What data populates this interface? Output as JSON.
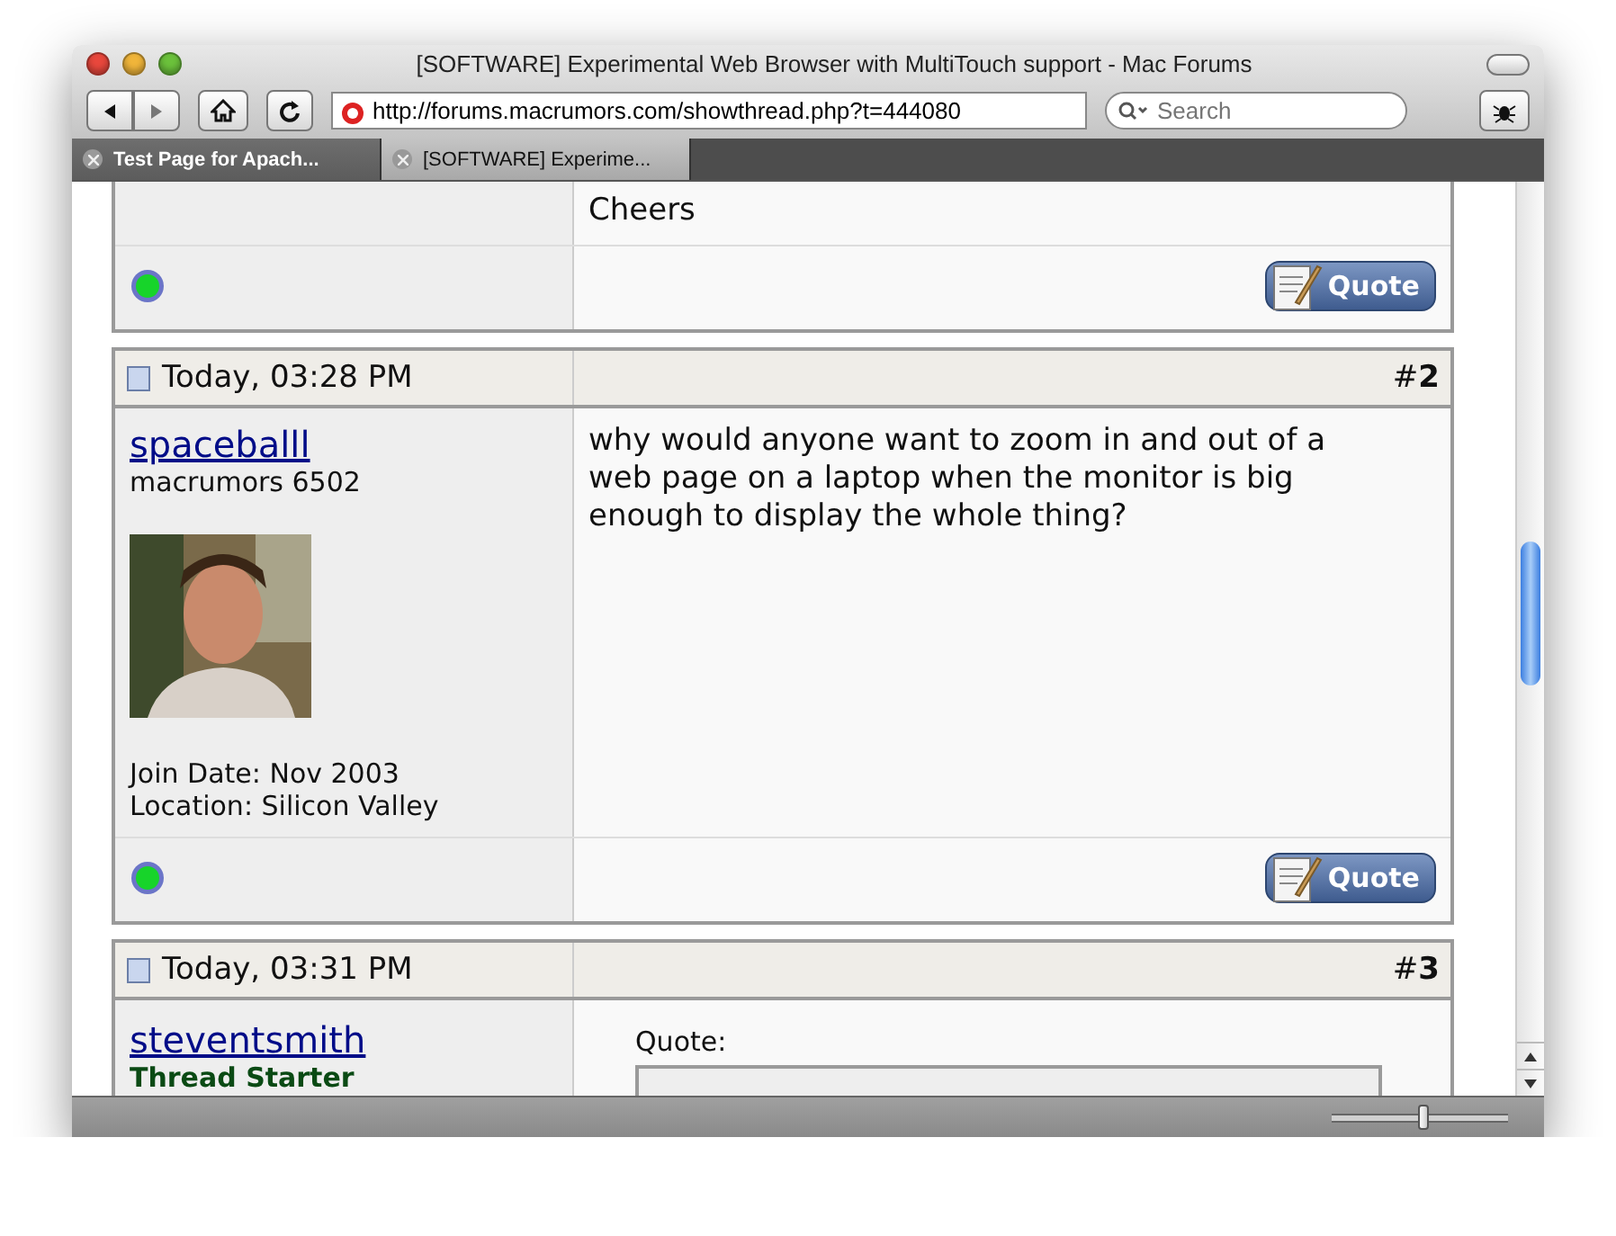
{
  "window": {
    "title": "[SOFTWARE] Experimental Web Browser with MultiTouch support - Mac Forums"
  },
  "toolbar": {
    "url": "http://forums.macrumors.com/showthread.php?t=444080",
    "search": {
      "placeholder": "Search"
    }
  },
  "tabs": [
    {
      "label": "Test Page for Apach...",
      "selected": false
    },
    {
      "label": "[SOFTWARE] Experime...",
      "selected": true
    }
  ],
  "previous_post": {
    "message": "Cheers",
    "online": true,
    "quote_button": "Quote"
  },
  "posts": [
    {
      "kind": "full",
      "date": "Today, 03:28 PM",
      "number": "#**2**",
      "user": {
        "name": "spaceballl",
        "title": "macrumors 6502",
        "join_date": "Join Date: Nov 2003",
        "location": "Location: Silicon Valley"
      },
      "message": "why would anyone want to zoom in and out of a web page on a laptop when the monitor is big enough to display the whole thing?",
      "online": true,
      "quote_button": "Quote"
    },
    {
      "kind": "cut",
      "date": "Today, 03:31 PM",
      "number": "#**3**",
      "user": {
        "name": "steventsmith",
        "rank": "Thread Starter"
      },
      "quote_label": "Quote:"
    }
  ],
  "zoom": {
    "level": 0.52
  }
}
